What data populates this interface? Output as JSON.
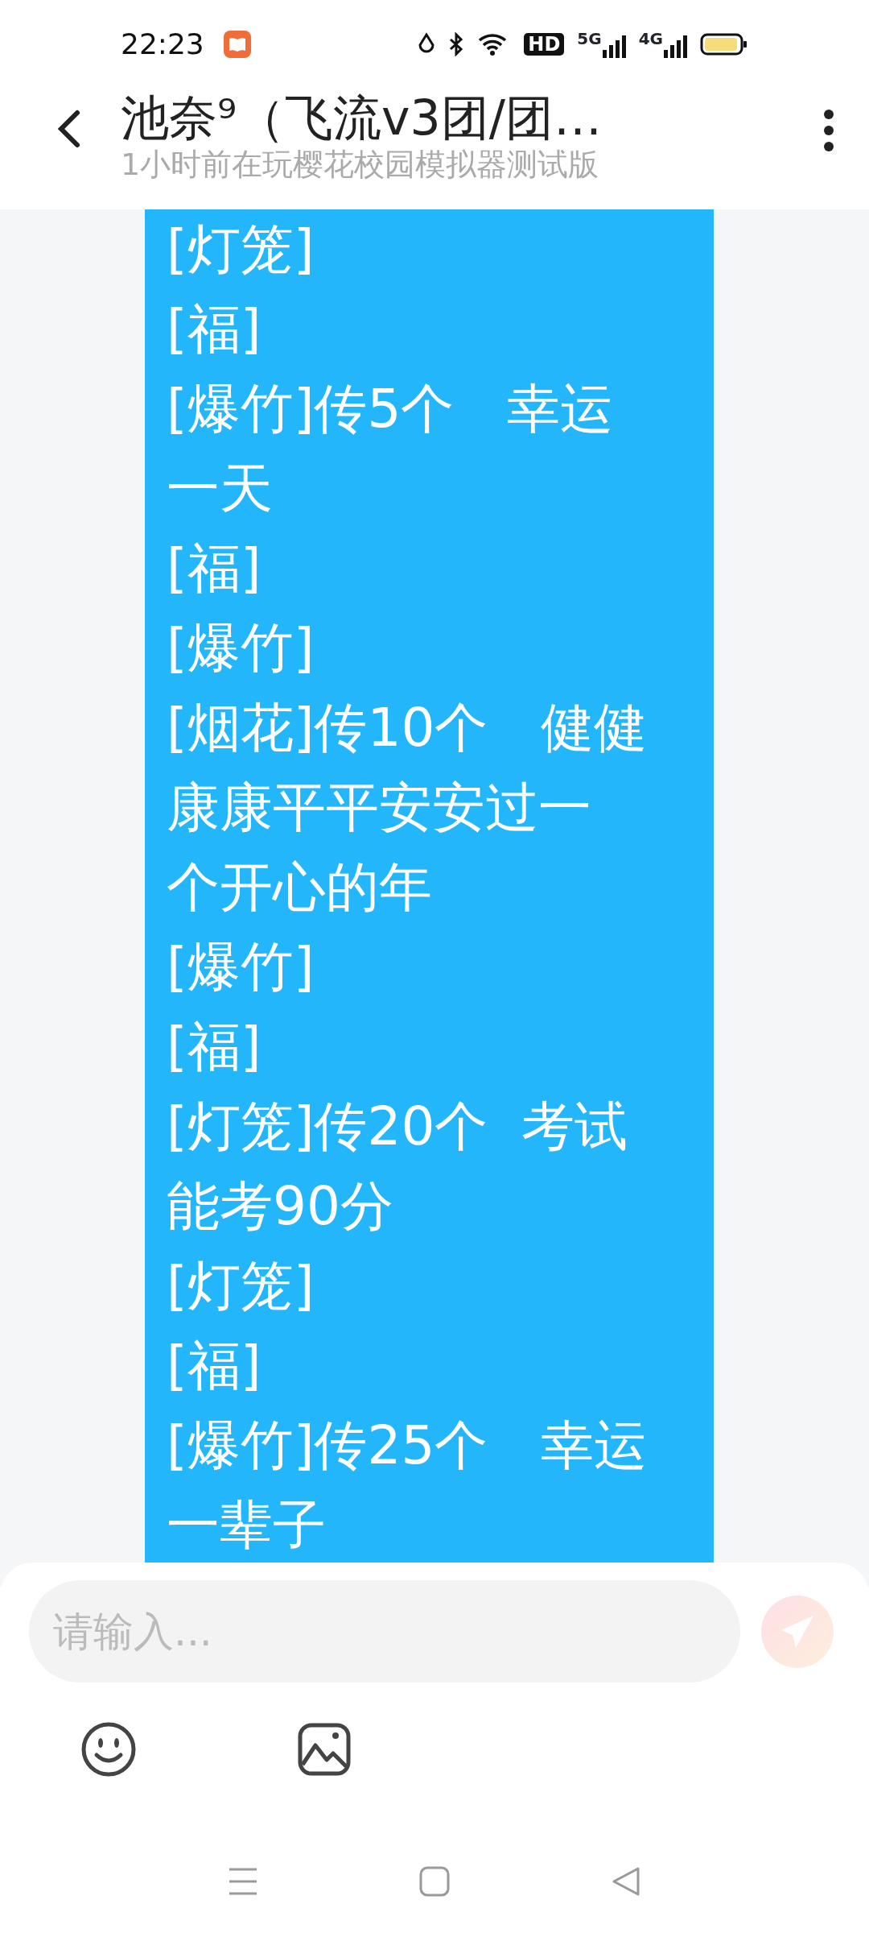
{
  "status_bar": {
    "time": "22:23",
    "hd": "HD",
    "networks": [
      "5G",
      "4G"
    ]
  },
  "header": {
    "title": "池奈⁹（飞流v3团/团…",
    "subtitle": "1小时前在玩樱花校园模拟器测试版"
  },
  "message": {
    "lines": [
      "[灯笼]",
      "[福]",
      "[爆竹]传5个　幸运",
      "一天",
      "[福]",
      "[爆竹]",
      "[烟花]传10个　健健",
      "康康平平安安过一",
      "个开心的年",
      "[爆竹]",
      "[福]",
      "[灯笼]传20个  考试",
      "能考90分",
      "[灯笼]",
      "[福]",
      "[爆竹]传25个　幸运",
      "一辈子"
    ]
  },
  "composer": {
    "placeholder": "请输入..."
  }
}
